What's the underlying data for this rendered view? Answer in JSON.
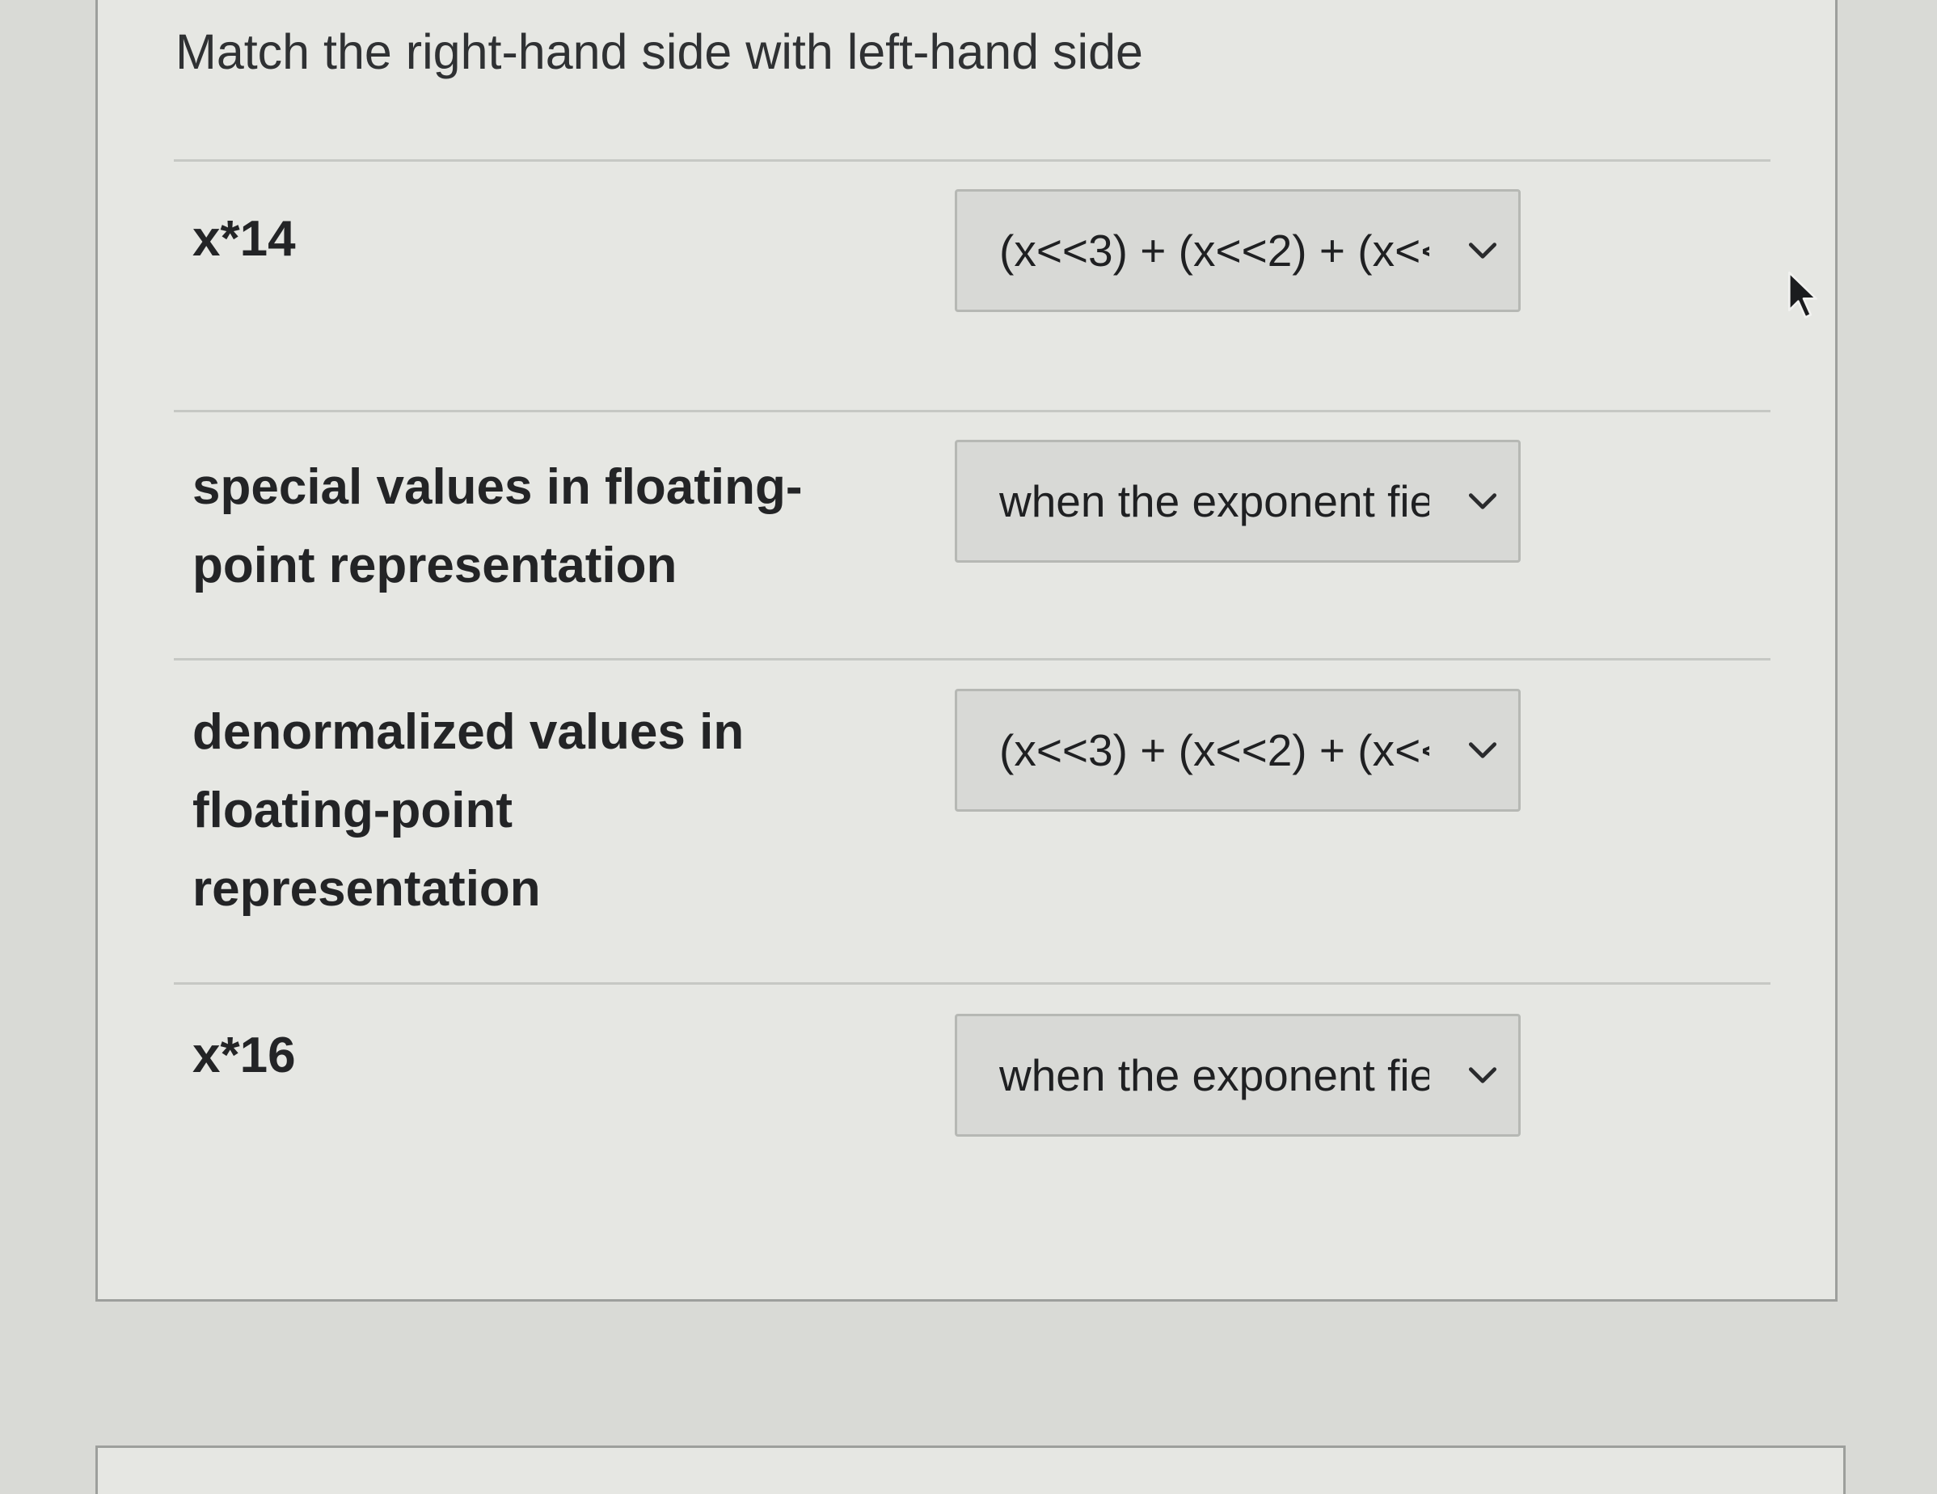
{
  "question": {
    "prompt": "Match the right-hand side with left-hand side",
    "rows": [
      {
        "label": "x*14",
        "selected": "(x<<3) + (x<<2) + (x<<"
      },
      {
        "label": "special values in floating-point representation",
        "selected": "when the exponent fie"
      },
      {
        "label": "denormalized values in floating-point representation",
        "selected": "(x<<3) + (x<<2) + (x<<"
      },
      {
        "label": "x*16",
        "selected": "when the exponent fie"
      }
    ]
  },
  "icons": {
    "dropdown": "chevron-down-icon",
    "pointer": "mouse-cursor-icon"
  },
  "colors": {
    "card_background": "#e6e7e3",
    "select_background": "#d8d9d6",
    "divider": "#c6c8c4"
  }
}
